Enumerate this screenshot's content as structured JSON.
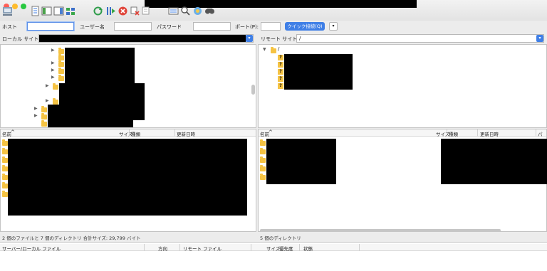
{
  "toolbar": {
    "icons": [
      "site-manager-icon",
      "toggle-log-icon",
      "toggle-local-tree-icon",
      "toggle-remote-tree-icon",
      "transfer-queue-icon",
      "refresh-icon",
      "process-queue-icon",
      "cancel-icon",
      "disconnect-icon",
      "reconnect-icon",
      "directory-listing-filters-icon",
      "filename-filter-icon",
      "sync-browsing-icon",
      "search-icon"
    ]
  },
  "quickconnect": {
    "host_label": "ホスト",
    "host_value": "",
    "user_label": "ユーザー名",
    "user_value": "",
    "password_label": "パスワード",
    "password_value": "",
    "port_label": "ポート(P):",
    "port_value": "",
    "connect_label": "クイック接続(Q)",
    "arrow_label": "▾"
  },
  "local": {
    "site_label": "ローカル サイト:",
    "site_value": "",
    "columns": {
      "name": "名前",
      "size": "サイズ",
      "type": "種類",
      "modified": "更新日時"
    },
    "status": "2 個のファイルと 7 個のディレクトリ 合計サイズ: 29,799 バイト"
  },
  "remote": {
    "site_label": "リモート サイト:",
    "site_value": "/",
    "columns": {
      "name": "名前",
      "size": "サイズ",
      "type": "種類",
      "modified": "更新日時",
      "perm": "パー"
    },
    "status": "5 個のディレクトリ",
    "tree_root": "/"
  },
  "queue": {
    "columns": {
      "server_local": "サーバー/ローカル ファイル",
      "direction": "方向",
      "remote_file": "リモート ファイル",
      "size": "サイズ",
      "priority": "優先度",
      "status": "状態"
    }
  },
  "colors": {
    "accent": "#3f7fe6",
    "folder": "#f5c343",
    "redaction": "#000000"
  }
}
